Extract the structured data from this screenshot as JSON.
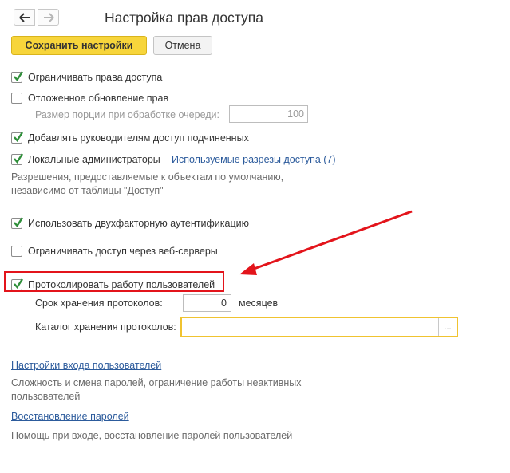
{
  "header": {
    "title": "Настройка прав доступа"
  },
  "toolbar": {
    "save_label": "Сохранить настройки",
    "cancel_label": "Отмена"
  },
  "options": {
    "restrict_access": {
      "label": "Ограничивать права доступа",
      "checked": true
    },
    "deferred_update": {
      "label": "Отложенное обновление прав",
      "checked": false
    },
    "queue_portion": {
      "label": "Размер порции при обработке очереди:",
      "value": "100"
    },
    "managers_access": {
      "label": "Добавлять руководителям доступ подчиненных",
      "checked": true
    },
    "local_admins": {
      "label": "Локальные администраторы",
      "checked": true,
      "link": "Используемые разрезы доступа (7)"
    },
    "local_admins_hint": "Разрешения, предоставляемые к объектам по умолчанию, независимо от таблицы \"Доступ\"",
    "two_factor": {
      "label": "Использовать двухфакторную аутентификацию",
      "checked": true
    },
    "web_servers": {
      "label": "Ограничивать доступ через веб-серверы",
      "checked": false
    },
    "log_users": {
      "label": "Протоколировать работу пользователей",
      "checked": true
    },
    "log_retention": {
      "label": "Срок хранения протоколов:",
      "value": "0",
      "unit": "месяцев"
    },
    "log_catalog": {
      "label": "Каталог хранения протоколов:",
      "value": "",
      "button": "..."
    }
  },
  "links": {
    "login_settings": {
      "label": "Настройки входа пользователей",
      "hint": "Сложность и смена паролей, ограничение работы неактивных пользователей"
    },
    "password_recovery": {
      "label": "Восстановление паролей",
      "hint": "Помощь при входе, восстановление паролей пользователей"
    }
  },
  "colors": {
    "accent_button": "#f7d53b",
    "check": "#2f8f3a",
    "link": "#2c5b9c",
    "highlight": "#e3141b",
    "focus": "#f0c330"
  }
}
